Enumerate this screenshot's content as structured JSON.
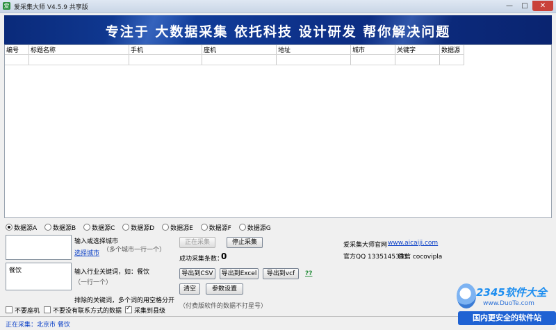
{
  "window": {
    "title": "爱采集大师 V4.5.9 共享版",
    "min_glyph": "—",
    "max_glyph": "□",
    "close_glyph": "✕",
    "app_icon": "爱"
  },
  "banner": {
    "slogan": "专注于 大数据采集 依托科技 设计研发 帮你解决问题"
  },
  "table": {
    "columns": [
      "编号",
      "标题名称",
      "手机",
      "座机",
      "地址",
      "城市",
      "关键字",
      "数据源"
    ],
    "rows": []
  },
  "sources": [
    {
      "label": "数据源A",
      "selected": true
    },
    {
      "label": "数据源B",
      "selected": false
    },
    {
      "label": "数据源C",
      "selected": false
    },
    {
      "label": "数据源D",
      "selected": false
    },
    {
      "label": "数据源E",
      "selected": false
    },
    {
      "label": "数据源F",
      "selected": false
    },
    {
      "label": "数据源G",
      "selected": false
    }
  ],
  "city": {
    "value": "",
    "label": "输入或选择城市",
    "select_link": "选择城市",
    "hint": "（多个城市一行一个）"
  },
  "keyword": {
    "value": "餐饮",
    "label": "输入行业关键词，如：餐饮",
    "hint": "（一行一个）"
  },
  "exclude": {
    "label": "排除的关键词，多个词的用空格分开"
  },
  "options": {
    "no_landline": {
      "label": "不要座机",
      "checked": false
    },
    "no_contact": {
      "label": "不要没有联系方式的数据",
      "checked": false
    },
    "to_county": {
      "label": "采集到县级",
      "checked": true
    }
  },
  "buttons": {
    "collecting": "正在采集",
    "stop": "停止采集",
    "export_csv": "导出到CSV",
    "export_excel": "导出到Excel",
    "export_vcf": "导出到vcf",
    "help": "??",
    "clear": "清空",
    "settings": "参数设置"
  },
  "success": {
    "label": "成功采集条数：",
    "count": "0"
  },
  "paid_note": "（付费版软件的数据不打星号）",
  "info": {
    "site_label": "爱采集大师官网",
    "site_url": "www.aicaiji.com",
    "qq": "官方QQ 1335145333",
    "wechat": "微信 cocovipla"
  },
  "status": "正在采集：北京市 餐饮",
  "watermark": {
    "logo": "2345软件大全",
    "site": "www.DuoTe.com",
    "slogan": "国内更安全的软件站"
  }
}
